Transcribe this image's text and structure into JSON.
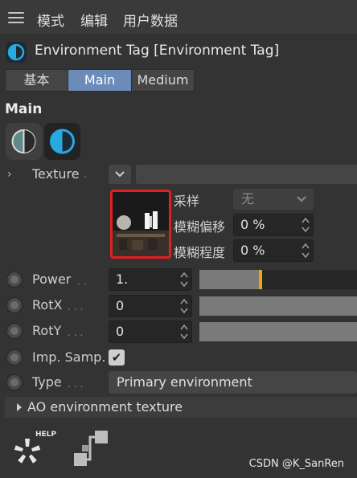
{
  "menu": {
    "items": [
      "模式",
      "编辑",
      "用户数据"
    ]
  },
  "window": {
    "title": "Environment Tag [Environment Tag]"
  },
  "tabs": [
    {
      "label": "基本",
      "active": false
    },
    {
      "label": "Main",
      "active": true
    },
    {
      "label": "Medium",
      "active": false
    }
  ],
  "section": {
    "title": "Main"
  },
  "texture": {
    "label": "Texture",
    "sampling_label": "采样",
    "sampling_value": "无",
    "blur_offset_label": "模糊偏移",
    "blur_offset_value": "0 %",
    "blur_amount_label": "模糊程度",
    "blur_amount_value": "0 %"
  },
  "params": {
    "power": {
      "label": "Power",
      "value": "1.",
      "slider_fraction": 0.38
    },
    "rotx": {
      "label": "RotX",
      "value": "0"
    },
    "roty": {
      "label": "RotY",
      "value": "0"
    },
    "imp_samp": {
      "label": "Imp. Samp.",
      "checked": true,
      "check_glyph": "✔"
    },
    "type": {
      "label": "Type",
      "value": "Primary environment"
    }
  },
  "ao": {
    "label": "AO environment texture"
  },
  "watermark": "CSDN @K_SanRen",
  "colors": {
    "accent_tab": "#6b8bb8",
    "highlight": "#e02020",
    "power_marker": "#f0a800",
    "tag_icon": "#27a9e1"
  }
}
